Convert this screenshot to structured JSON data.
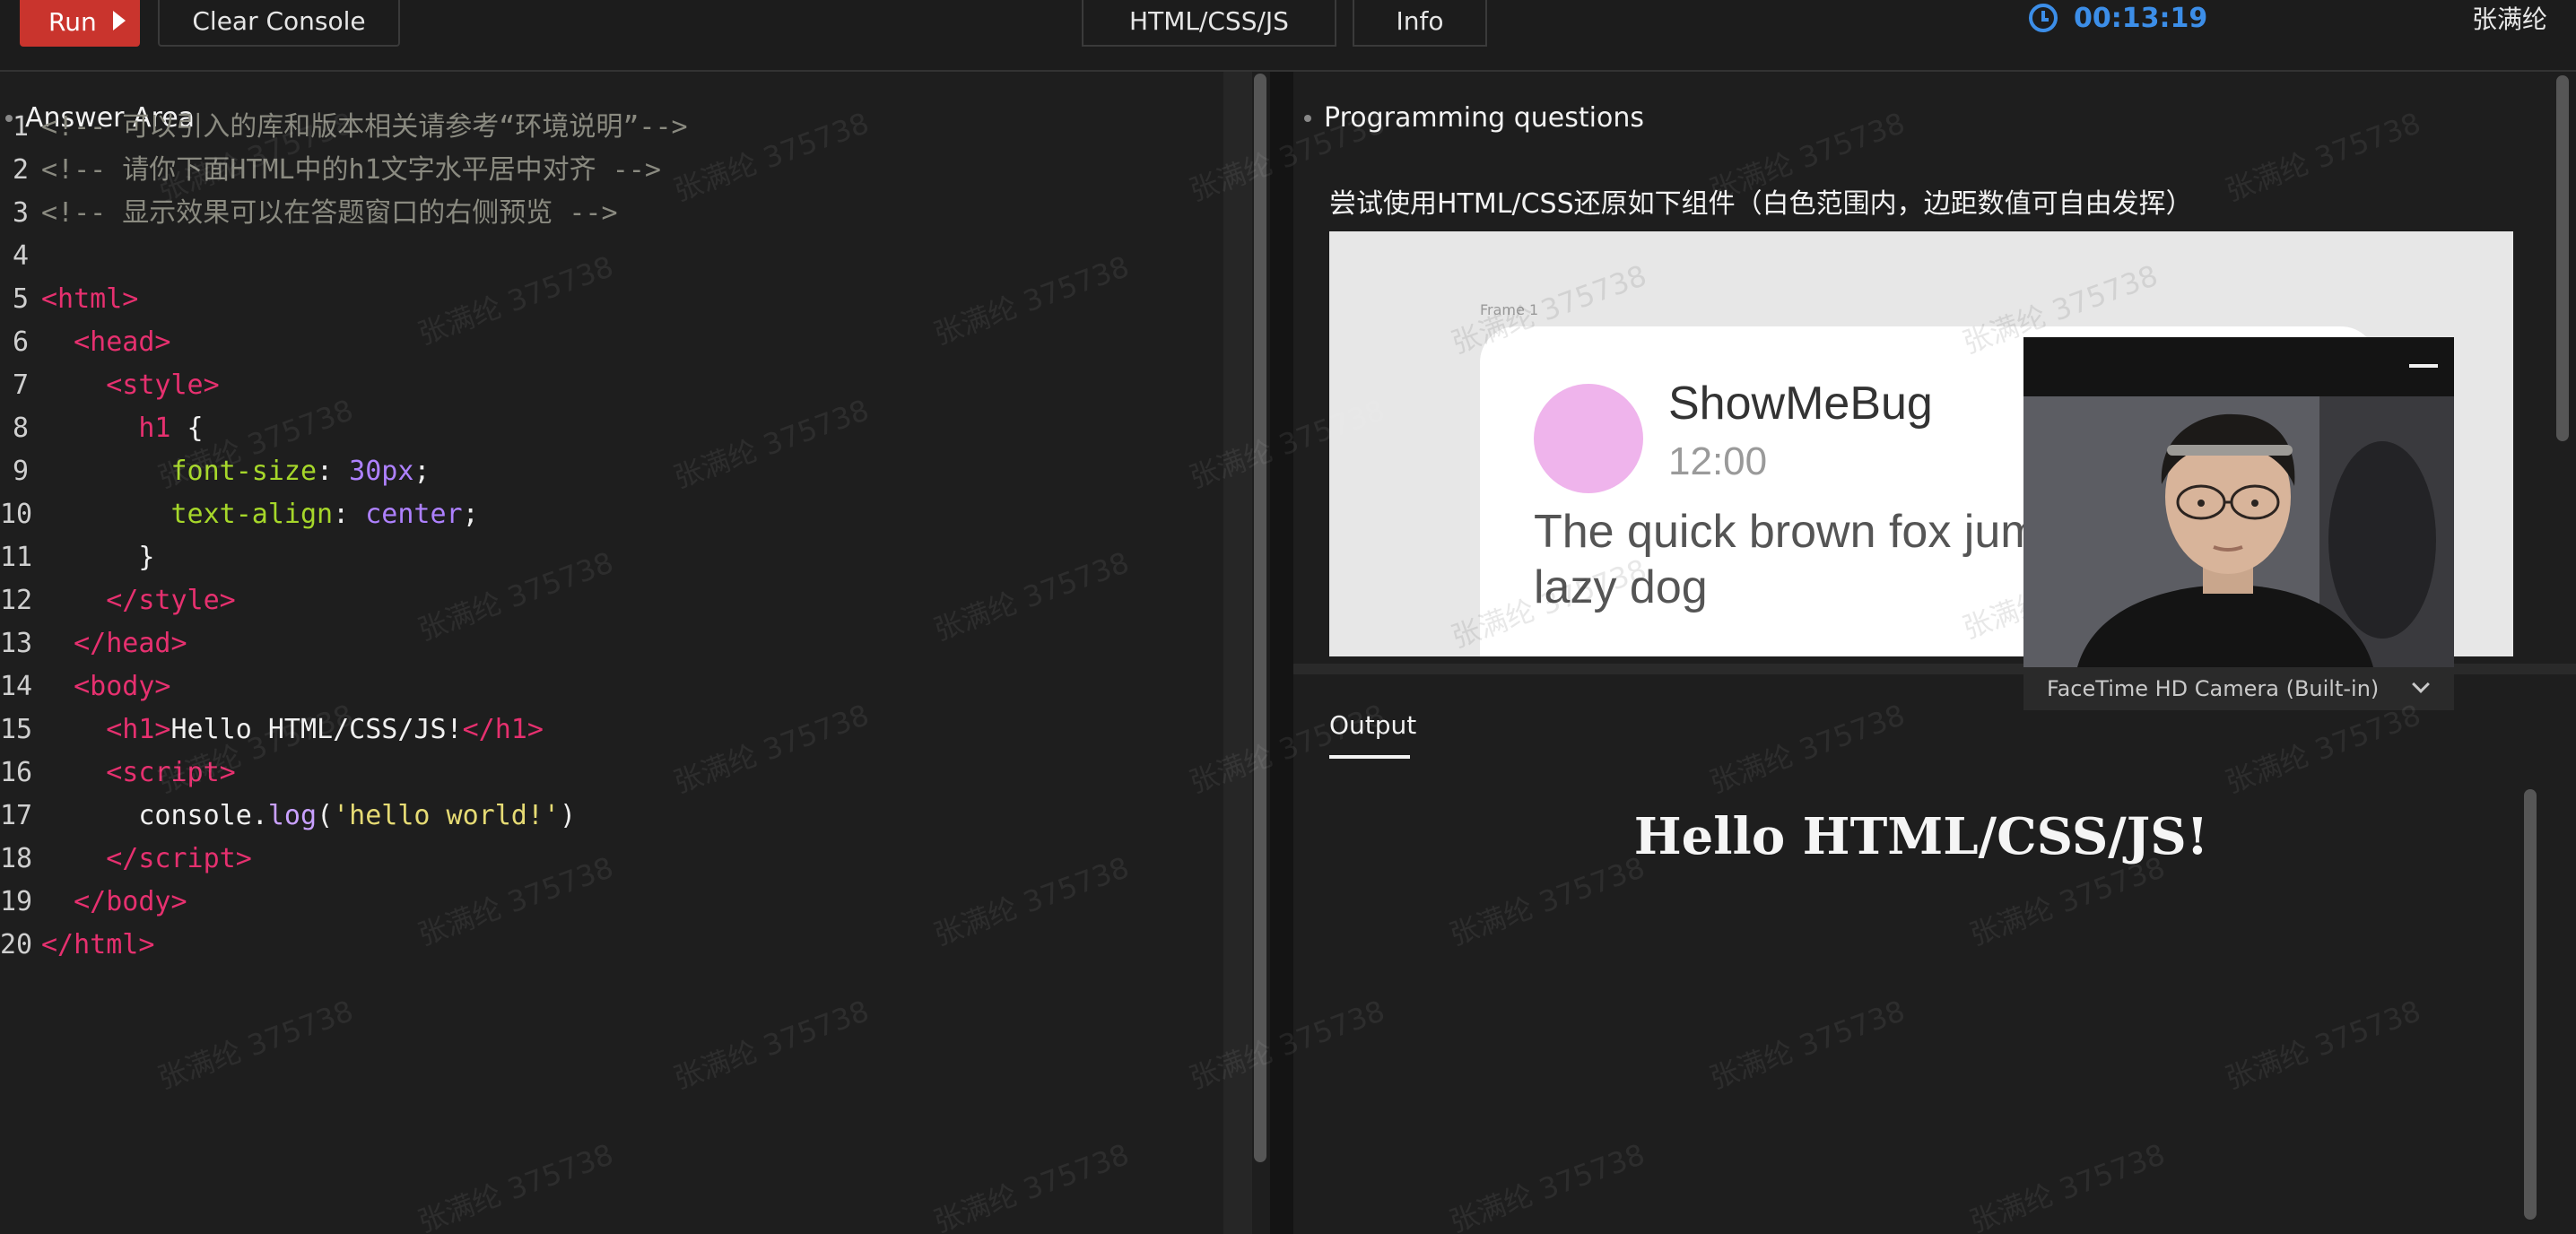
{
  "toolbar": {
    "run_label": "Run",
    "clear_label": "Clear Console",
    "language_label": "HTML/CSS/JS",
    "info_label": "Info",
    "timer": "00:13:19",
    "username": "张满纶"
  },
  "editor": {
    "title": "Answer Area",
    "line_numbers": [
      "1",
      "2",
      "3",
      "4",
      "5",
      "6",
      "7",
      "8",
      "9",
      "10",
      "11",
      "12",
      "13",
      "14",
      "15",
      "16",
      "17",
      "18",
      "19",
      "20"
    ]
  },
  "question": {
    "title": "Programming questions",
    "text": "尝试使用HTML/CSS还原如下组件（白色范围内，边距数值可自由发挥）",
    "preview_card": {
      "label": "Frame 1",
      "name": "ShowMeBug",
      "time": "12:00",
      "message": "The quick brown fox jumps over the lazy dog"
    }
  },
  "output": {
    "tab_label": "Output",
    "rendered_h1": "Hello HTML/CSS/JS!"
  },
  "camera": {
    "device_label": "FaceTime HD Camera (Built-in)"
  },
  "watermark": "张满纶 375738",
  "colors": {
    "run": "#c9342d",
    "timer": "#3c8ee8",
    "avatar": "#efb4ec"
  }
}
